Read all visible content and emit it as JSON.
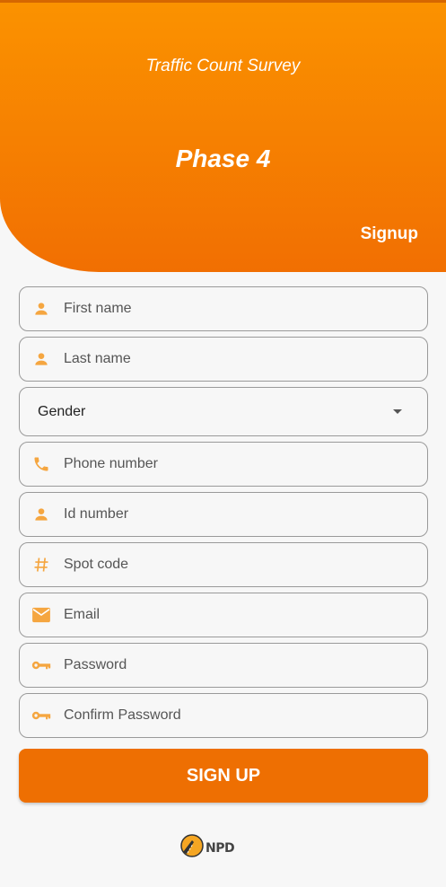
{
  "header": {
    "subtitle": "Traffic Count Survey",
    "phase": "Phase 4",
    "tab": "Signup",
    "gradient_top": "#fb9200",
    "gradient_bottom": "#f16f02"
  },
  "form": {
    "first_name": {
      "placeholder": "First name",
      "icon": "person-icon"
    },
    "last_name": {
      "placeholder": "Last name",
      "icon": "person-icon"
    },
    "gender": {
      "value": "Gender",
      "icon": "caret-down-icon"
    },
    "phone": {
      "placeholder": "Phone number",
      "icon": "phone-icon"
    },
    "id_number": {
      "placeholder": "Id number",
      "icon": "person-icon"
    },
    "spot_code": {
      "placeholder": "Spot code",
      "icon": "hash-icon"
    },
    "email": {
      "placeholder": "Email",
      "icon": "mail-icon"
    },
    "password": {
      "placeholder": "Password",
      "icon": "key-icon"
    },
    "confirm_password": {
      "placeholder": "Confirm Password",
      "icon": "key-icon"
    }
  },
  "submit_label": "SIGN UP",
  "footer": {
    "logo_text": "NPD"
  },
  "colors": {
    "accent": "#ee6f02",
    "icon": "#f5a640",
    "border": "#9a9a9a"
  }
}
